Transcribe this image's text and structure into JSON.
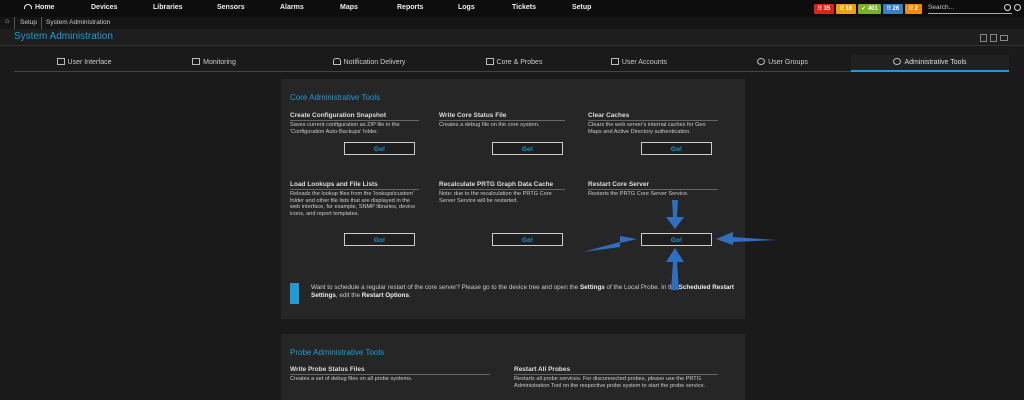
{
  "nav": {
    "home": "Home",
    "devices": "Devices",
    "libraries": "Libraries",
    "sensors": "Sensors",
    "alarms": "Alarms",
    "maps": "Maps",
    "reports": "Reports",
    "logs": "Logs",
    "tickets": "Tickets",
    "setup": "Setup"
  },
  "badges": [
    {
      "label": "!! 35",
      "color": "#d9251d"
    },
    {
      "label": "!! 16",
      "color": "#e8a40c"
    },
    {
      "label": "✓ 401",
      "color": "#77b128"
    },
    {
      "label": "!! 26",
      "color": "#3a7fc1"
    },
    {
      "label": "!! 2",
      "color": "#e88c14"
    }
  ],
  "search": {
    "placeholder": "Search..."
  },
  "breadcrumb": {
    "setup": "Setup",
    "current": "System Administration"
  },
  "page_title": "System Administration",
  "tabs": [
    {
      "label": "User Interface",
      "active": false
    },
    {
      "label": "Monitoring",
      "active": false
    },
    {
      "label": "Notification Delivery",
      "active": false
    },
    {
      "label": "Core & Probes",
      "active": false
    },
    {
      "label": "User Accounts",
      "active": false
    },
    {
      "label": "User Groups",
      "active": false
    },
    {
      "label": "Administrative Tools",
      "active": true
    }
  ],
  "core": {
    "title": "Core Administrative Tools",
    "tools": [
      {
        "title": "Create Configuration Snapshot",
        "desc": "Saves current configuration as ZIP file in the 'Configuration Auto-Backups' folder.",
        "button": "Go!"
      },
      {
        "title": "Write Core Status File",
        "desc": "Creates a debug file on the core system.",
        "button": "Go!"
      },
      {
        "title": "Clear Caches",
        "desc": "Clears the web server's internal caches for Geo Maps and Active Directory authentication.",
        "button": "Go!"
      },
      {
        "title": "Load Lookups and File Lists",
        "desc": "Reloads the lookup files from the 'lookups\\custom' folder and other file lists that are displayed in the web interface, for example, SNMP libraries, device icons, and report templates.",
        "button": "Go!"
      },
      {
        "title": "Recalculate PRTG Graph Data Cache",
        "desc": "Note: due to the recalculation the PRTG Core Server Service will be restarted.",
        "button": "Go!"
      },
      {
        "title": "Restart Core Server",
        "desc": "Restarts the PRTG Core Server Service.",
        "button": "Go!"
      }
    ],
    "info": {
      "t1": "Want to schedule a regular restart of the core server? Please go to the device tree and open the ",
      "b1": "Settings",
      "t2": " of the Local Probe. In the ",
      "b2": "Scheduled Restart Settings",
      "t3": ", edit the ",
      "b3": "Restart Options",
      "t4": "."
    }
  },
  "probe": {
    "title": "Probe Administrative Tools",
    "tools": [
      {
        "title": "Write Probe Status Files",
        "desc": "Creates a set of debug files on all probe systems."
      },
      {
        "title": "Restart All Probes",
        "desc": "Restarts all probe services. For disconnected probes, please use the PRTG Administration Tool on the respective probe system to start the probe service."
      }
    ]
  },
  "colors": {
    "accent": "#1e9bd7",
    "arrow": "#2f6fc0"
  }
}
